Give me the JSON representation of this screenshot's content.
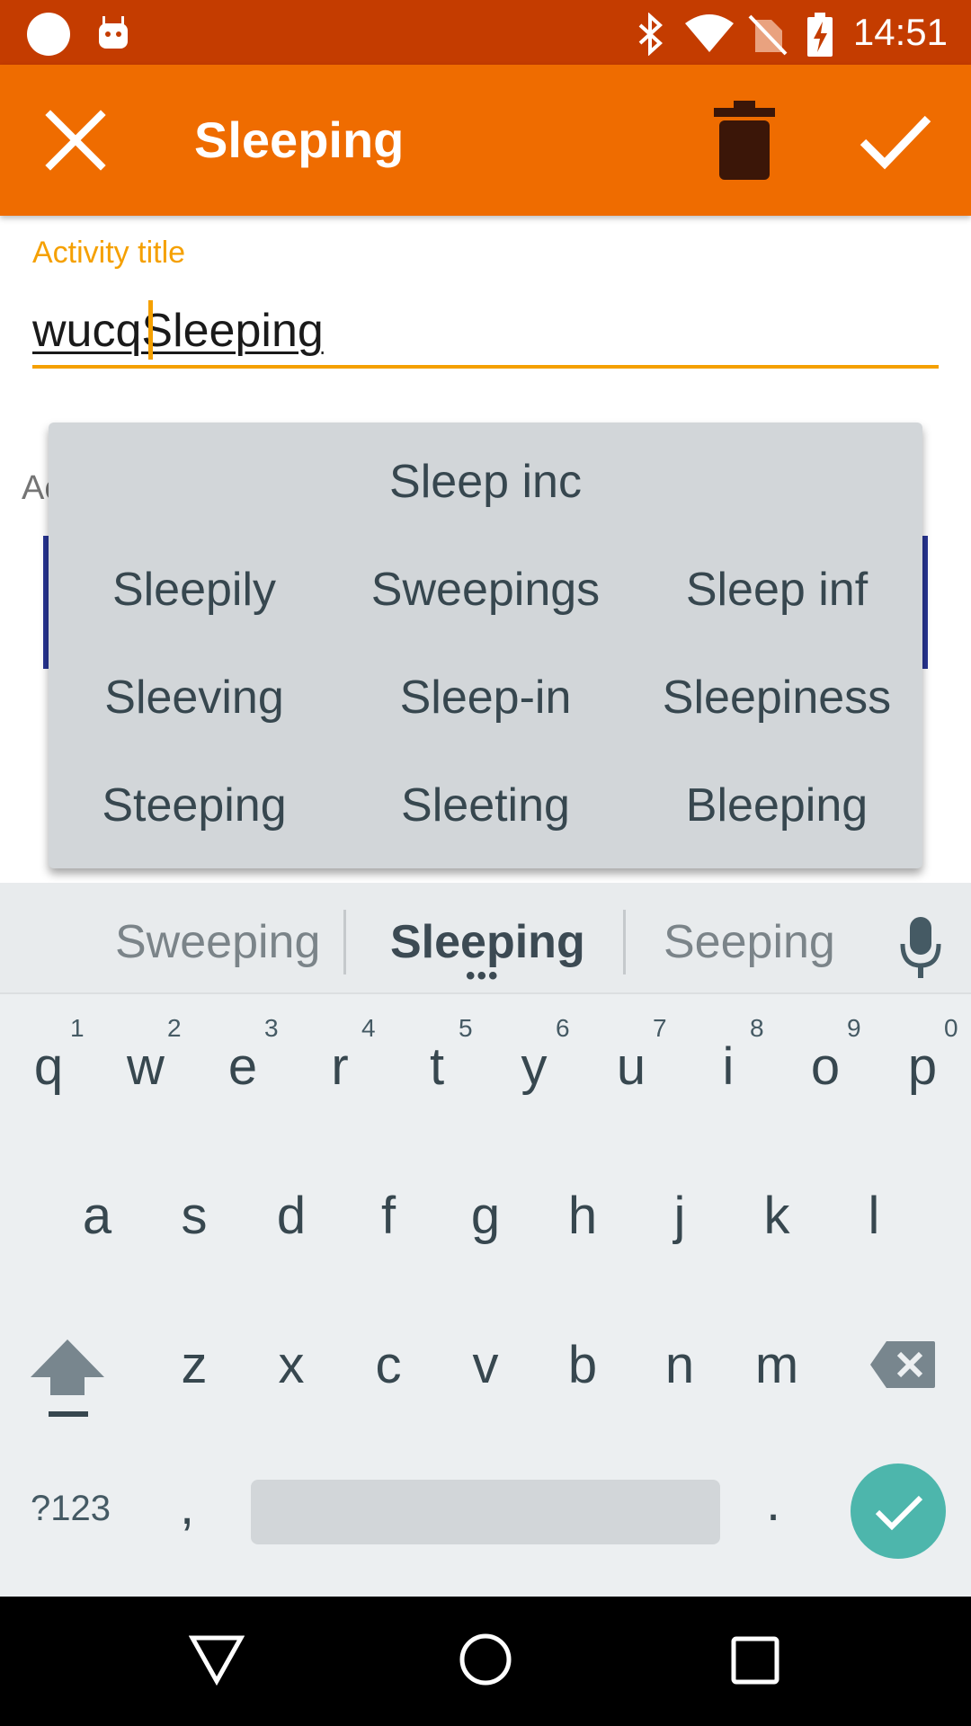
{
  "status_bar": {
    "time": "14:51",
    "icons": [
      "notification-dot-icon",
      "android-icon",
      "bluetooth-icon",
      "wifi-icon",
      "no-sim-icon",
      "battery-charging-icon"
    ]
  },
  "toolbar": {
    "title": "Sleeping",
    "close_icon": "close-icon",
    "delete_icon": "trash-icon",
    "save_icon": "check-icon"
  },
  "form": {
    "title_label": "Activity title",
    "title_value": "wucqSleeping",
    "partial_label": "Ac"
  },
  "suggestions_popup": {
    "top": "Sleep inc",
    "rows": [
      [
        "Sleepily",
        "Sweepings",
        "Sleep inf"
      ],
      [
        "Sleeving",
        "Sleep-in",
        "Sleepiness"
      ],
      [
        "Steeping",
        "Sleeting",
        "Bleeping"
      ]
    ]
  },
  "keyboard": {
    "strip": {
      "left": "Sweeping",
      "center": "Sleeping",
      "right": "Seeping",
      "more": "•••"
    },
    "row1": [
      "q",
      "w",
      "e",
      "r",
      "t",
      "y",
      "u",
      "i",
      "o",
      "p"
    ],
    "row1_hints": [
      "1",
      "2",
      "3",
      "4",
      "5",
      "6",
      "7",
      "8",
      "9",
      "0"
    ],
    "row2": [
      "a",
      "s",
      "d",
      "f",
      "g",
      "h",
      "j",
      "k",
      "l"
    ],
    "row3": [
      "z",
      "x",
      "c",
      "v",
      "b",
      "n",
      "m"
    ],
    "symbols_label": "?123",
    "comma": ",",
    "period": ".",
    "colors": {
      "done": "#4DB6AC",
      "accent": "#F5A000",
      "toolbar": "#EF6C00"
    }
  },
  "nav_bar": {
    "icons": [
      "back-icon",
      "home-icon",
      "recents-icon"
    ]
  }
}
